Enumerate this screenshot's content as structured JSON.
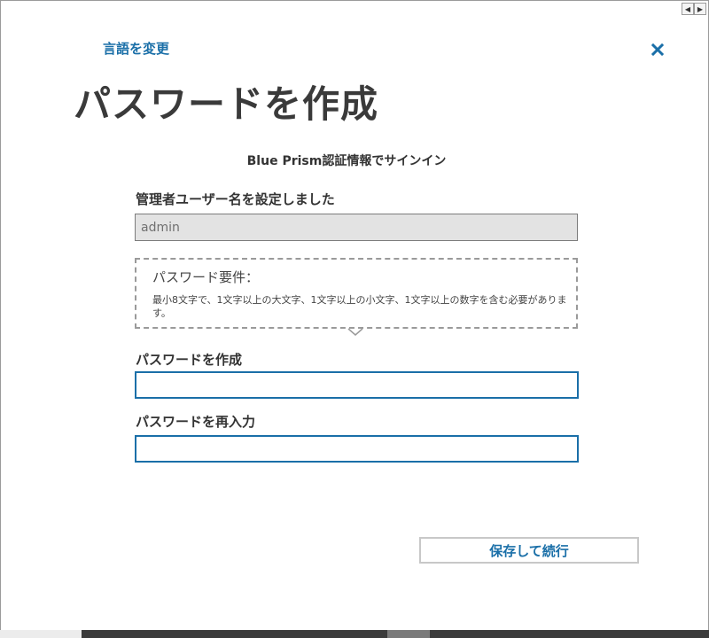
{
  "header": {
    "change_language": "言語を変更",
    "close_icon": "close-icon"
  },
  "page": {
    "title": "パスワードを作成",
    "subtitle": "Blue Prism認証情報でサインイン"
  },
  "admin": {
    "label": "管理者ユーザー名を設定しました",
    "value": "admin"
  },
  "requirements": {
    "title": "パスワード要件：",
    "text": "最小8文字で、1文字以上の大文字、1文字以上の小文字、1文字以上の数字を含む必要があります。"
  },
  "password": {
    "label": "パスワードを作成",
    "value": ""
  },
  "confirm": {
    "label": "パスワードを再入力",
    "value": ""
  },
  "actions": {
    "save_label": "保存して続行"
  },
  "colors": {
    "accent": "#1a6fa8",
    "title": "#3a3a3a",
    "readonly_bg": "#e3e3e3"
  }
}
